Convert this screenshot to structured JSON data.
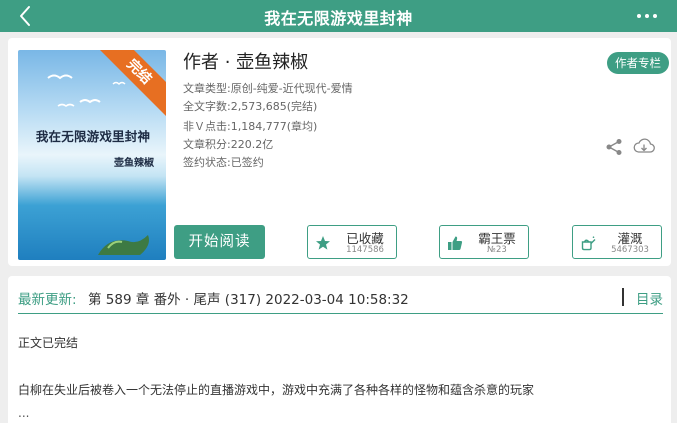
{
  "header": {
    "title": "我在无限游戏里封神"
  },
  "cover": {
    "title": "我在无限游戏里封神",
    "author": "壶鱼辣椒",
    "ribbon": "完结"
  },
  "book": {
    "author_line": "作者 · 壶鱼辣椒",
    "type": "文章类型:原创-纯爱-近代现代-爱情",
    "word_count": "全文字数:2,573,685(完结)",
    "clicks": "非Ｖ点击:1,184,777(章均)",
    "score": "文章积分:220.2亿",
    "sign_status": "签约状态:已签约",
    "author_column": "作者专栏"
  },
  "actions": {
    "read_label": "开始阅读",
    "collect_label": "已收藏",
    "collect_count": "1147586",
    "overlord_label": "霸王票",
    "overlord_rank": "№23",
    "water_label": "灌溉",
    "water_count": "5467303"
  },
  "update": {
    "label": "最新更新:",
    "text": "第 589 章 番外 · 尾声 (317)  2022-03-04 10:58:32",
    "catalog_label": "目录"
  },
  "summary": {
    "status": "正文已完结",
    "description": "白柳在失业后被卷入一个无法停止的直播游戏中，游戏中充满了各种各样的怪物和蕴含杀意的玩家",
    "ellipsis": "..."
  },
  "colors": {
    "accent": "#3e9e84",
    "ribbon": "#e76f22"
  }
}
